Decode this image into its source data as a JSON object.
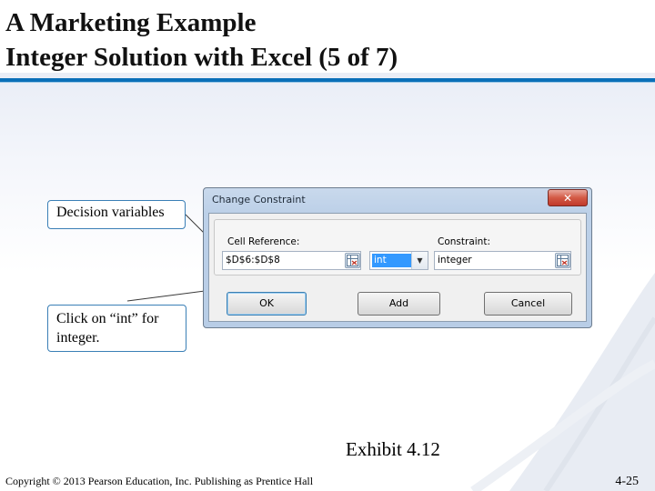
{
  "slide": {
    "title_line1": "A Marketing Example",
    "title_line2": "Integer Solution with Excel (5 of 7)",
    "exhibit": "Exhibit 4.12",
    "copyright": "Copyright © 2013 Pearson Education, Inc. Publishing as Prentice Hall",
    "page_number": "4-25"
  },
  "callouts": {
    "decision_variables": "Decision variables",
    "click_int_line1": "Click on “int” for",
    "click_int_line2": "integer."
  },
  "dialog": {
    "title": "Change Constraint",
    "close_glyph": "✕",
    "cell_reference_label": "Cell Reference:",
    "cell_reference_value": "$D$6:$D$8",
    "operator_value": "int",
    "constraint_label": "Constraint:",
    "constraint_value": "integer",
    "ok_label": "OK",
    "add_label": "Add",
    "cancel_label": "Cancel"
  },
  "colors": {
    "title_rule": "#0a6fb8",
    "callout_border": "#3a7fb6",
    "selection_highlight": "#3399ff",
    "close_button": "#c0392b"
  },
  "icons": {
    "close": "close-icon",
    "range_picker": "range-select-icon",
    "dropdown": "chevron-down-icon"
  }
}
